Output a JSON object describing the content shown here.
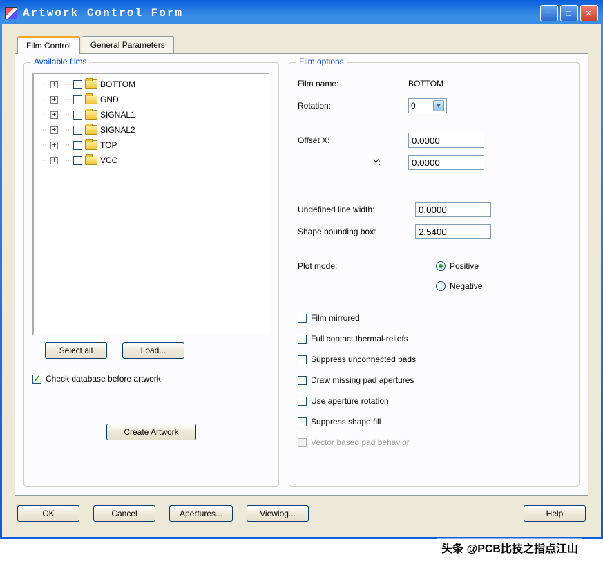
{
  "window": {
    "title": "Artwork Control Form"
  },
  "tabs": {
    "film_control": "Film Control",
    "general_params": "General Parameters"
  },
  "available": {
    "legend": "Available films",
    "items": [
      {
        "label": "BOTTOM"
      },
      {
        "label": "GND"
      },
      {
        "label": "SIGNAL1"
      },
      {
        "label": "SIGNAL2"
      },
      {
        "label": "TOP"
      },
      {
        "label": "VCC"
      }
    ],
    "select_all": "Select all",
    "load": "Load...",
    "check_db": "Check database before artwork",
    "create": "Create Artwork"
  },
  "options": {
    "legend": "Film options",
    "film_name_lbl": "Film name:",
    "film_name_val": "BOTTOM",
    "rotation_lbl": "Rotation:",
    "rotation_val": "0",
    "offset_x_lbl": "Offset  X:",
    "offset_x_val": "0.0000",
    "offset_y_lbl": "Y:",
    "offset_y_val": "0.0000",
    "undef_lw_lbl": "Undefined line width:",
    "undef_lw_val": "0.0000",
    "shape_bb_lbl": "Shape bounding box:",
    "shape_bb_val": "2.5400",
    "plot_mode_lbl": "Plot mode:",
    "positive": "Positive",
    "negative": "Negative",
    "film_mirrored": "Film mirrored",
    "full_contact": "Full contact thermal-reliefs",
    "suppress_pads": "Suppress unconnected pads",
    "draw_missing": "Draw missing pad apertures",
    "use_aperture": "Use aperture rotation",
    "suppress_fill": "Suppress shape fill",
    "vector_pad": "Vector based pad behavior"
  },
  "buttons": {
    "ok": "OK",
    "cancel": "Cancel",
    "apertures": "Apertures...",
    "viewlog": "Viewlog...",
    "help": "Help"
  },
  "watermark": "头条 @PCB比技之指点江山"
}
